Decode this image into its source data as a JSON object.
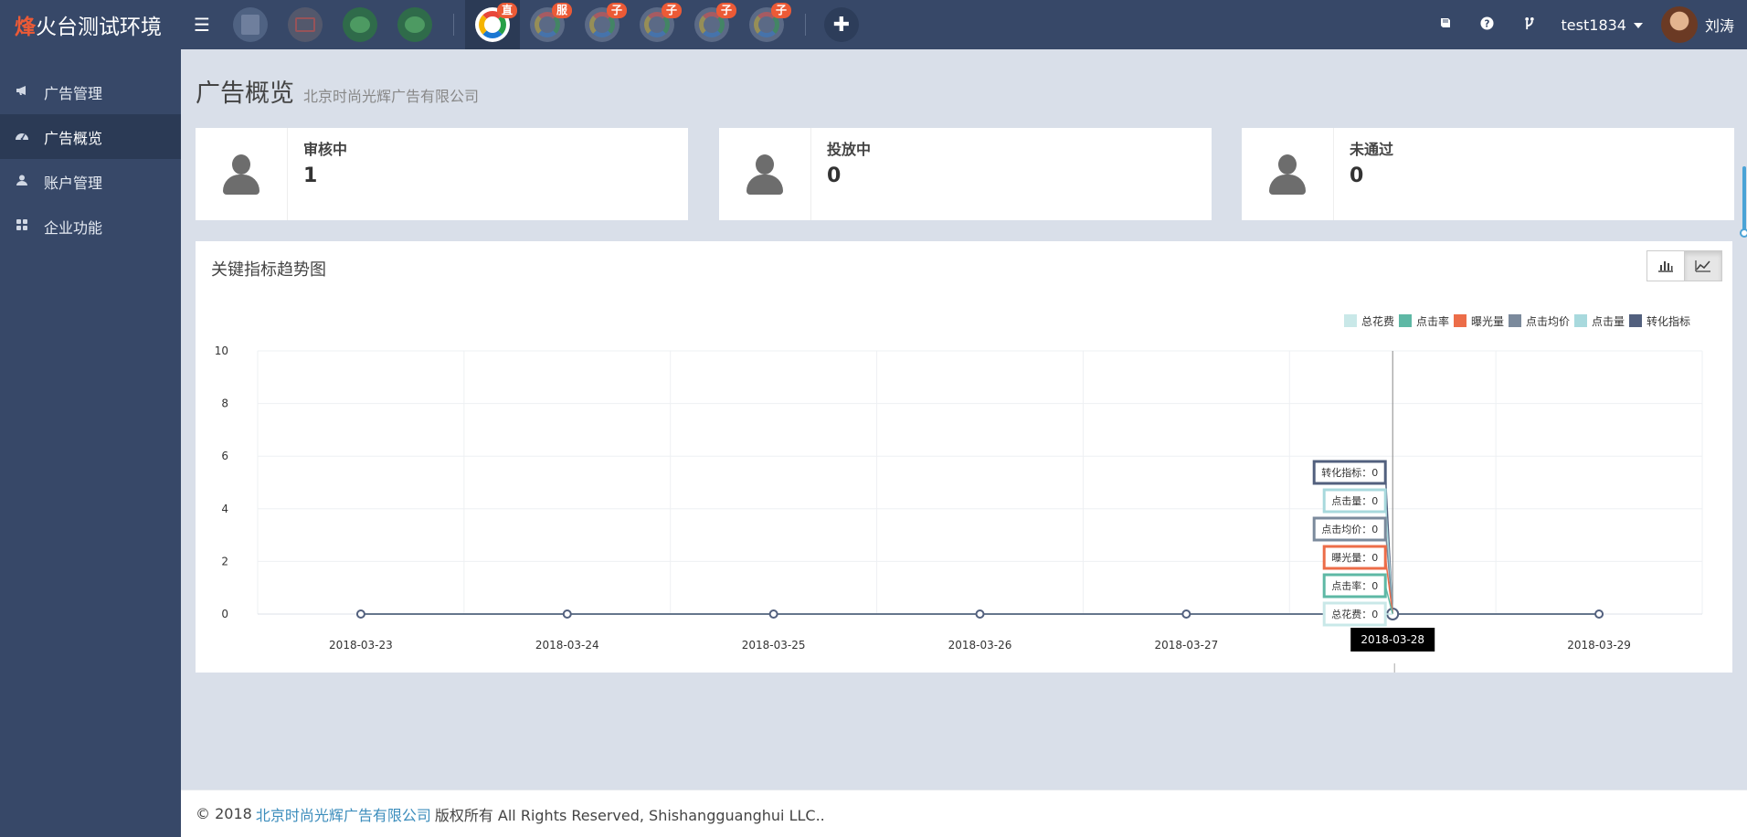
{
  "brand": {
    "accent": "烽",
    "rest": "火台测试环境"
  },
  "apps": [
    {
      "icon": "app-icon-1",
      "badge": ""
    },
    {
      "icon": "app-icon-2",
      "badge": ""
    },
    {
      "icon": "wechat-icon",
      "badge": ""
    },
    {
      "icon": "wechat-icon",
      "badge": ""
    },
    {
      "icon": "main-app-icon",
      "badge": "直"
    },
    {
      "icon": "service-app-icon",
      "badge": "服"
    },
    {
      "icon": "sub-app-icon",
      "badge": "子"
    },
    {
      "icon": "sub-app-icon",
      "badge": "子"
    },
    {
      "icon": "sub-app-icon",
      "badge": "子"
    },
    {
      "icon": "sub-app-icon",
      "badge": "子"
    }
  ],
  "topbar": {
    "username": "test1834",
    "display_name": "刘涛",
    "plus": "✚"
  },
  "sidebar": {
    "items": [
      {
        "label": "广告管理",
        "icon": "megaphone-icon"
      },
      {
        "label": "广告概览",
        "icon": "dashboard-icon"
      },
      {
        "label": "账户管理",
        "icon": "user-icon"
      },
      {
        "label": "企业功能",
        "icon": "grid-icon"
      }
    ]
  },
  "page": {
    "title": "广告概览",
    "subtitle": "北京时尚光辉广告有限公司"
  },
  "stats": [
    {
      "label": "审核中",
      "value": "1"
    },
    {
      "label": "投放中",
      "value": "0"
    },
    {
      "label": "未通过",
      "value": "0"
    }
  ],
  "panel": {
    "title": "关键指标趋势图"
  },
  "chart_data": {
    "type": "line",
    "x": [
      "2018-03-23",
      "2018-03-24",
      "2018-03-25",
      "2018-03-26",
      "2018-03-27",
      "2018-03-28",
      "2018-03-29"
    ],
    "ylim": [
      0,
      10
    ],
    "yticks": [
      0,
      2,
      4,
      6,
      8,
      10
    ],
    "grid": true,
    "legend_position": "top-right",
    "series": [
      {
        "name": "总花费",
        "color": "#c9e8e8",
        "values": [
          0,
          0,
          0,
          0,
          0,
          0,
          0
        ]
      },
      {
        "name": "点击率",
        "color": "#5eb8a5",
        "values": [
          0,
          0,
          0,
          0,
          0,
          0,
          0
        ]
      },
      {
        "name": "曝光量",
        "color": "#ec6d49",
        "values": [
          0,
          0,
          0,
          0,
          0,
          0,
          0
        ]
      },
      {
        "name": "点击均价",
        "color": "#7b8a9c",
        "values": [
          0,
          0,
          0,
          0,
          0,
          0,
          0
        ]
      },
      {
        "name": "点击量",
        "color": "#a8d9dd",
        "values": [
          0,
          0,
          0,
          0,
          0,
          0,
          0
        ]
      },
      {
        "name": "转化指标",
        "color": "#52607e",
        "values": [
          0,
          0,
          0,
          0,
          0,
          0,
          0
        ]
      }
    ],
    "tooltip": {
      "x": "2018-03-28",
      "items": [
        {
          "name": "转化指标",
          "value": 0
        },
        {
          "name": "点击量",
          "value": 0
        },
        {
          "name": "点击均价",
          "value": 0
        },
        {
          "name": "曝光量",
          "value": 0
        },
        {
          "name": "点击率",
          "value": 0
        },
        {
          "name": "总花费",
          "value": 0
        }
      ]
    }
  },
  "footer": {
    "prefix": "© 2018",
    "company": "北京时尚光辉广告有限公司",
    "suffix": "版权所有 All Rights Reserved, Shishangguanghui LLC.."
  }
}
